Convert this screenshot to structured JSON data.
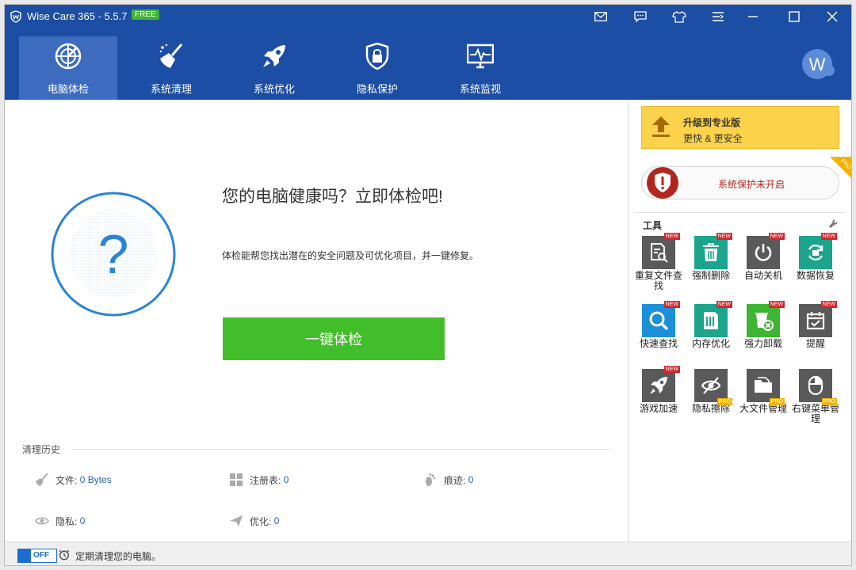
{
  "titlebar": {
    "title": "Wise Care 365 - 5.5.7",
    "edition_badge": "FREE"
  },
  "nav": [
    {
      "label": "电脑体检",
      "icon": "radar-icon",
      "active": true
    },
    {
      "label": "系统清理",
      "icon": "broom-icon"
    },
    {
      "label": "系统优化",
      "icon": "rocket-icon"
    },
    {
      "label": "隐私保护",
      "icon": "shield-lock-icon"
    },
    {
      "label": "系统监视",
      "icon": "monitor-icon"
    }
  ],
  "avatar": {
    "letter": "W"
  },
  "main": {
    "headline": "您的电脑健康吗？立即体检吧!",
    "description": "体检能帮您找出潜在的安全问题及可优化项目，并一键修复。",
    "check_button": "一键体检",
    "health_symbol": "?"
  },
  "history": {
    "title": "清理历史",
    "items": [
      {
        "label": "文件:",
        "value": "0 Bytes",
        "icon": "broom-icon"
      },
      {
        "label": "注册表:",
        "value": "0",
        "icon": "registry-icon"
      },
      {
        "label": "痕迹:",
        "value": "0",
        "icon": "footprint-icon"
      },
      {
        "label": "隐私:",
        "value": "0",
        "icon": "eye-icon"
      },
      {
        "label": "优化:",
        "value": "0",
        "icon": "paper-plane-icon"
      }
    ]
  },
  "right": {
    "upgrade_title": "升级到专业版",
    "upgrade_sub": "更快 & 更安全",
    "protect_text": "系统保护未开启",
    "pro_corner": "PRO",
    "tools_title": "工具",
    "tools": [
      {
        "label": "重复文件查找",
        "icon": "duplicate-file-icon",
        "badge": "NEW",
        "color": "#5a5a5a"
      },
      {
        "label": "强制删除",
        "icon": "trash-icon",
        "badge": "NEW",
        "color": "#1aa58c"
      },
      {
        "label": "自动关机",
        "icon": "power-icon",
        "badge": "NEW",
        "color": "#5a5a5a"
      },
      {
        "label": "数据恢复",
        "icon": "recover-icon",
        "badge": "NEW",
        "color": "#1aa58c"
      },
      {
        "label": "快速查找",
        "icon": "search-icon",
        "badge": "NEW",
        "color": "#1b8fd8"
      },
      {
        "label": "内存优化",
        "icon": "memory-icon",
        "badge": "NEW",
        "color": "#1aa58c"
      },
      {
        "label": "强力卸载",
        "icon": "uninstall-icon",
        "badge": "NEW",
        "color": "#3fb534"
      },
      {
        "label": "提醒",
        "icon": "calendar-icon",
        "badge": "NEW",
        "color": "#5a5a5a"
      },
      {
        "label": "游戏加速",
        "icon": "game-rocket-icon",
        "badge": "NEW",
        "color": "#5a5a5a"
      },
      {
        "label": "隐私擦除",
        "icon": "eye-off-icon",
        "badge": "PRO",
        "color": "#5a5a5a"
      },
      {
        "label": "大文件管理",
        "icon": "folder-icon",
        "badge": "PRO",
        "color": "#5a5a5a"
      },
      {
        "label": "右键菜单管理",
        "icon": "mouse-icon",
        "badge": "PRO",
        "color": "#5a5a5a"
      }
    ]
  },
  "statusbar": {
    "toggle": "OFF",
    "text": "定期清理您的电脑。"
  },
  "colors": {
    "nav_bg": "#1d4ea5",
    "nav_active": "#3d6cbf",
    "primary_button": "#43be2b",
    "upgrade_bg": "#fbd24a",
    "alert_red": "#b3261e"
  }
}
